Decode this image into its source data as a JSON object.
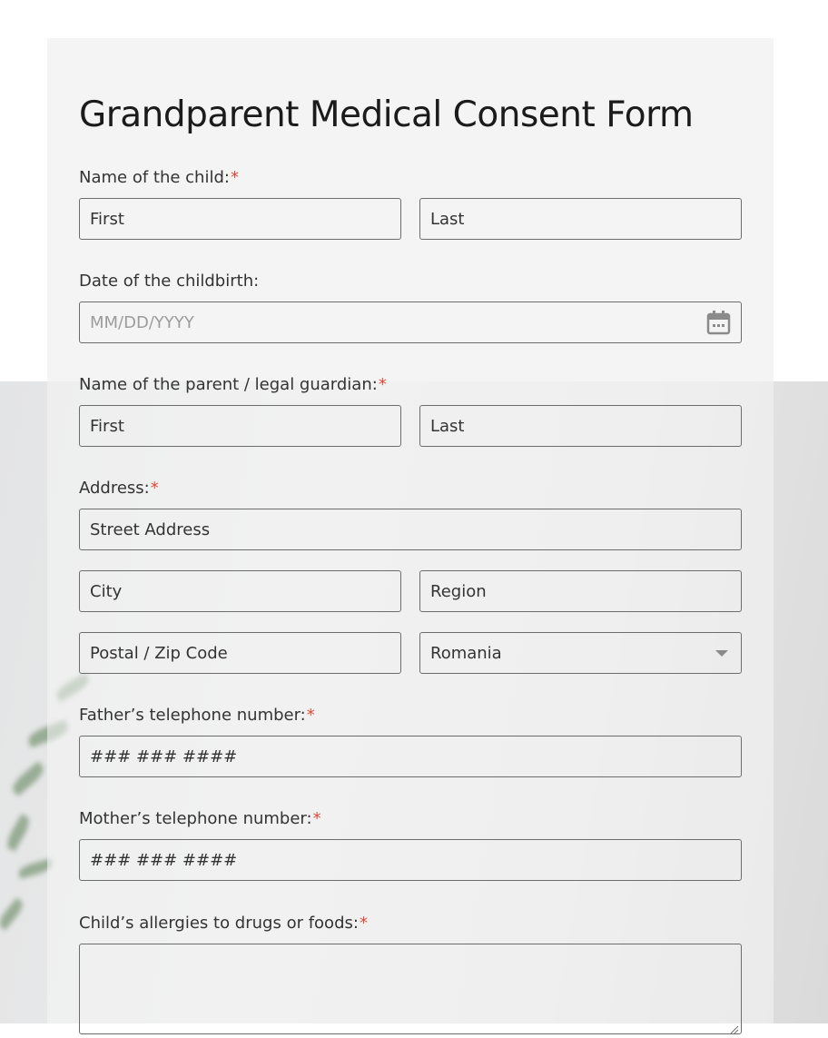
{
  "form": {
    "title": "Grandparent Medical Consent Form",
    "child_name": {
      "label": "Name of the child:",
      "required_mark": "*",
      "first_placeholder": "First",
      "last_placeholder": "Last"
    },
    "childbirth_date": {
      "label": "Date of the childbirth:",
      "placeholder": "MM/DD/YYYY",
      "icon": "calendar-icon"
    },
    "parent_name": {
      "label": "Name of the parent / legal guardian:",
      "required_mark": "*",
      "first_placeholder": "First",
      "last_placeholder": "Last"
    },
    "address": {
      "label": "Address:",
      "required_mark": "*",
      "street_placeholder": "Street Address",
      "city_placeholder": "City",
      "region_placeholder": "Region",
      "postal_placeholder": "Postal / Zip Code",
      "country_value": "Romania",
      "country_icon": "chevron-down-icon"
    },
    "father_phone": {
      "label": "Father’s telephone number:",
      "required_mark": "*",
      "placeholder": "### ### ####"
    },
    "mother_phone": {
      "label": "Mother’s telephone number:",
      "required_mark": "*",
      "placeholder": "### ### ####"
    },
    "allergies": {
      "label": "Child’s allergies to drugs or foods:",
      "required_mark": "*"
    }
  },
  "colors": {
    "required": "#e0493b",
    "border": "#6c6c6c",
    "card": "#f4f4f4"
  }
}
